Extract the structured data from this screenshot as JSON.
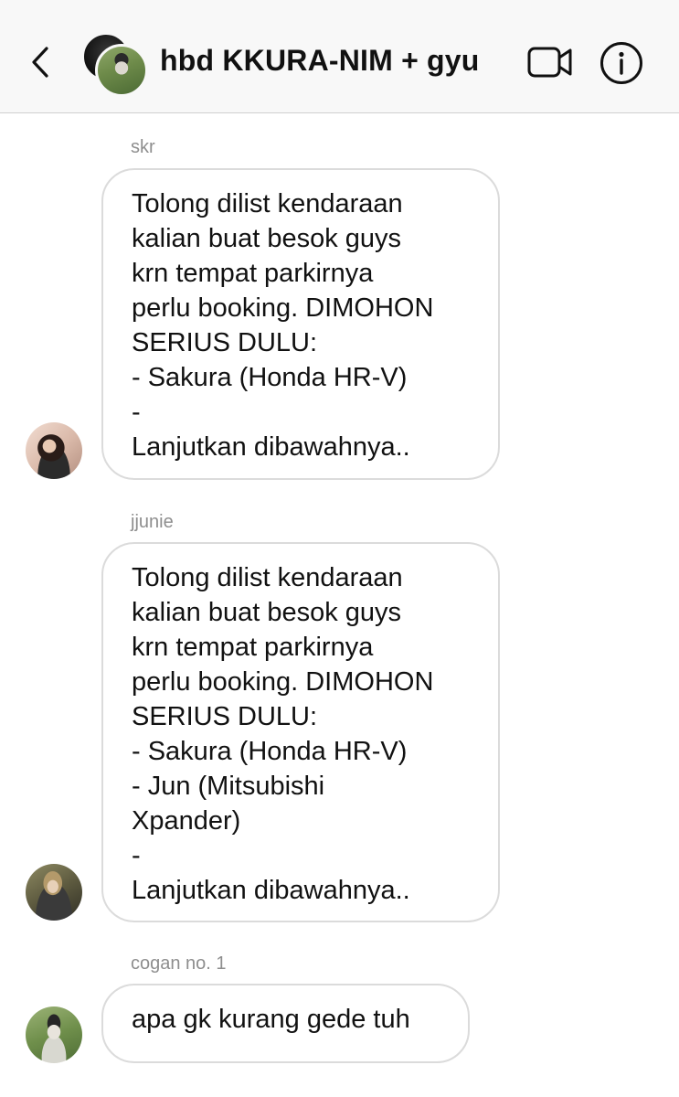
{
  "header": {
    "title": "hbd KKURA-NIM + gyu",
    "back_icon": "chevron-left-icon",
    "video_icon": "video-camera-icon",
    "info_icon": "info-icon"
  },
  "messages": [
    {
      "sender": "skr",
      "text": "Tolong dilist kendaraan\nkalian buat besok guys\nkrn tempat parkirnya\nperlu booking. DIMOHON\nSERIUS DULU:\n- Sakura (Honda HR-V)\n-\nLanjutkan dibawahnya.."
    },
    {
      "sender": "jjunie",
      "text": "Tolong dilist kendaraan\nkalian buat besok guys\nkrn tempat parkirnya\nperlu booking. DIMOHON\nSERIUS DULU:\n- Sakura (Honda HR-V)\n- Jun (Mitsubishi\nXpander)\n-\nLanjutkan dibawahnya.."
    },
    {
      "sender": "cogan no. 1",
      "text": "apa gk kurang gede tuh"
    }
  ],
  "colors": {
    "header_bg": "#f8f8f8",
    "bubble_border": "#dbdbdb",
    "sender_text": "#8e8e8e"
  }
}
